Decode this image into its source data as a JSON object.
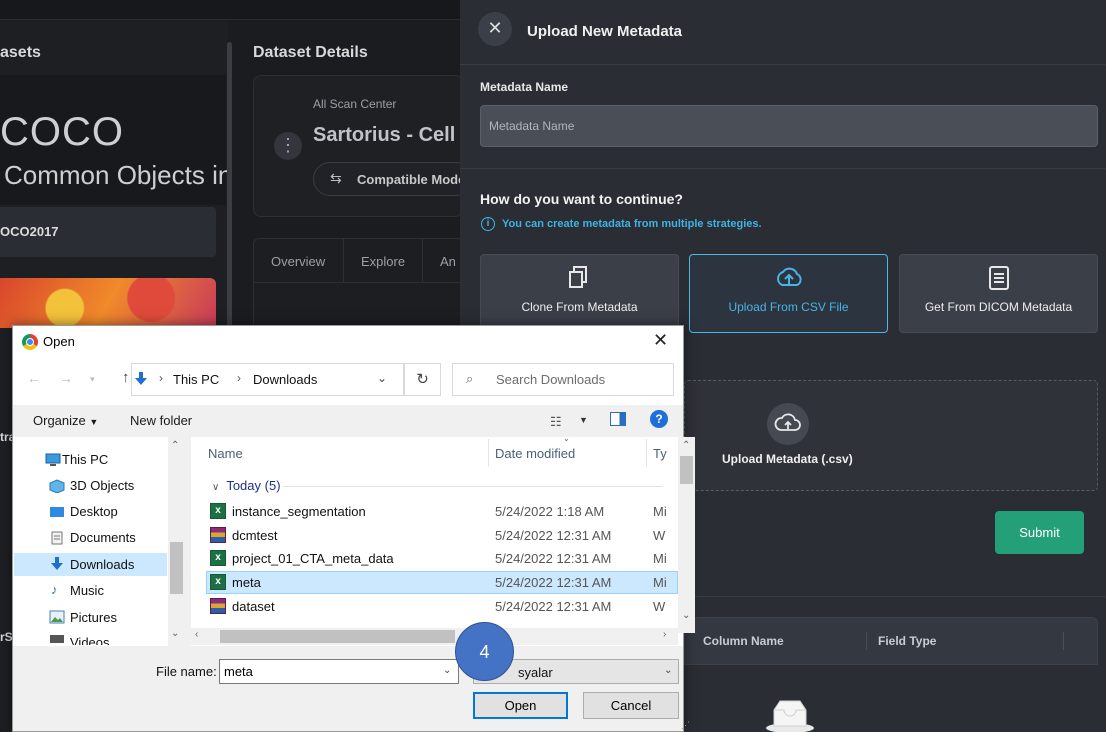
{
  "app": {
    "left_panel_title": "asets",
    "hero_big": "COCO",
    "hero_sub": "Common Objects in",
    "dataset_selected": "OCO2017",
    "left_clip_labels": [
      "tra",
      "rS"
    ]
  },
  "details": {
    "title": "Dataset Details",
    "scan_center": "All Scan Center",
    "dataset_name": "Sartorius - Cell",
    "compatible_button": "Compatible Mode",
    "tabs": [
      "Overview",
      "Explore",
      "An"
    ]
  },
  "panel": {
    "title": "Upload New Metadata",
    "name_label": "Metadata Name",
    "name_placeholder": "Metadata Name",
    "how_title": "How do you want to continue?",
    "info_text": "You can create metadata from multiple strategies.",
    "strategies": [
      {
        "label": "Clone From Metadata",
        "icon": "copy-icon"
      },
      {
        "label": "Upload From CSV File",
        "icon": "cloud-upload-icon",
        "active": true
      },
      {
        "label": "Get From DICOM Metadata",
        "icon": "document-icon"
      }
    ],
    "upload_label": "Upload Metadata (.csv)",
    "submit": "Submit",
    "table_columns": [
      "Column Name",
      "Field Type"
    ],
    "accent": "#3fb2e6",
    "submit_color": "#23a077"
  },
  "dialog": {
    "title": "Open",
    "path": [
      "This PC",
      "Downloads"
    ],
    "search_placeholder": "Search Downloads",
    "organize": "Organize",
    "new_folder": "New folder",
    "tree": [
      "This PC",
      "3D Objects",
      "Desktop",
      "Documents",
      "Downloads",
      "Music",
      "Pictures",
      "Videos"
    ],
    "tree_selected": "Downloads",
    "columns": [
      "Name",
      "Date modified",
      "Ty"
    ],
    "group": "Today (5)",
    "files": [
      {
        "name": "instance_segmentation",
        "date": "5/24/2022 1:18 AM",
        "type": "Mi",
        "icon": "excel-icon"
      },
      {
        "name": "dcmtest",
        "date": "5/24/2022 12:31 AM",
        "type": "W",
        "icon": "winrar-icon"
      },
      {
        "name": "project_01_CTA_meta_data",
        "date": "5/24/2022 12:31 AM",
        "type": "Mi",
        "icon": "excel-icon"
      },
      {
        "name": "meta",
        "date": "5/24/2022 12:31 AM",
        "type": "Mi",
        "icon": "excel-icon",
        "selected": true
      },
      {
        "name": "dataset",
        "date": "5/24/2022 12:31 AM",
        "type": "W",
        "icon": "winrar-icon"
      }
    ],
    "file_name_label": "File name:",
    "file_name_value": "meta",
    "file_type": "syalar",
    "open_button": "Open",
    "cancel_button": "Cancel"
  },
  "step_badge": "4"
}
